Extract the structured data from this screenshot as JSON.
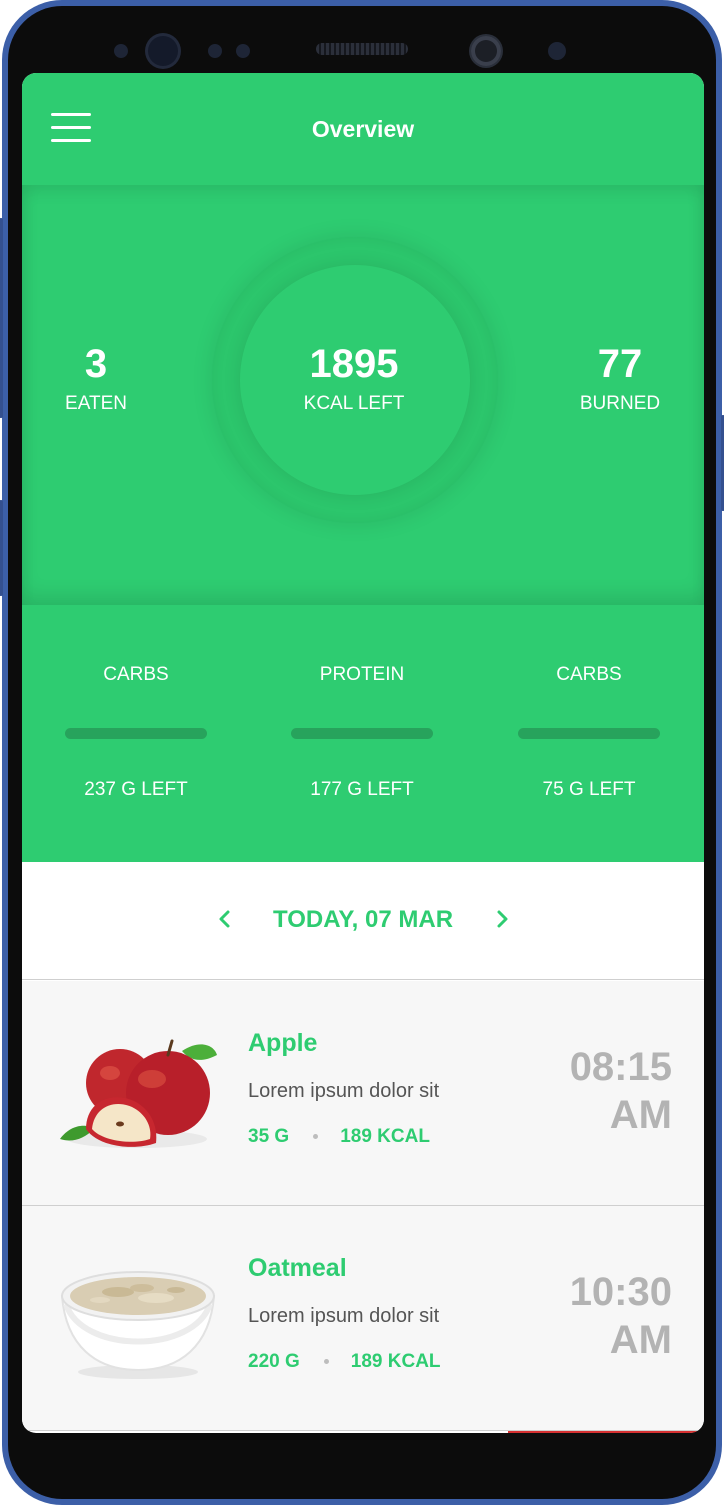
{
  "header": {
    "title": "Overview"
  },
  "summary": {
    "eaten": {
      "value": "3",
      "label": "EATEN"
    },
    "kcal_left": {
      "value": "1895",
      "label": "KCAL LEFT"
    },
    "burned": {
      "value": "77",
      "label": "BURNED"
    }
  },
  "macros": [
    {
      "name": "CARBS",
      "left": "237 G LEFT"
    },
    {
      "name": "PROTEIN",
      "left": "177 G LEFT"
    },
    {
      "name": "CARBS",
      "left": "75 G LEFT"
    }
  ],
  "date_nav": {
    "label": "TODAY, 07 MAR"
  },
  "meals": [
    {
      "name": "Apple",
      "description": "Lorem ipsum dolor sit",
      "weight": "35 G",
      "kcal": "189 KCAL",
      "time": "08:15",
      "ampm": "AM",
      "icon": "apple-image"
    },
    {
      "name": "Oatmeal",
      "description": "Lorem ipsum dolor sit",
      "weight": "220 G",
      "kcal": "189 KCAL",
      "time": "10:30",
      "ampm": "AM",
      "icon": "oatmeal-image"
    }
  ],
  "colors": {
    "accent": "#2ecc71",
    "accent_dark": "#27a35c",
    "time_gray": "#b3b3b3",
    "background": "#f7f7f7",
    "frame": "#3c5fa8"
  }
}
